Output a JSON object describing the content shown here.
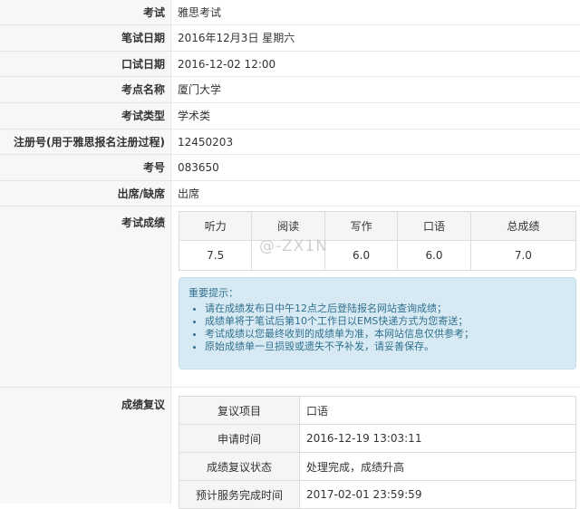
{
  "rows": [
    {
      "label": "考试",
      "value": "雅思考试"
    },
    {
      "label": "笔试日期",
      "value": "2016年12月3日 星期六"
    },
    {
      "label": "口试日期",
      "value": "2016-12-02 12:00"
    },
    {
      "label": "考点名称",
      "value": "厦门大学"
    },
    {
      "label": "考试类型",
      "value": "学术类"
    },
    {
      "label": "注册号(用于雅思报名注册过程)",
      "value": "12450203"
    },
    {
      "label": "考号",
      "value": "083650"
    },
    {
      "label": "出席/缺席",
      "value": "出席"
    }
  ],
  "scores": {
    "label": "考试成绩",
    "headers": [
      "听力",
      "阅读",
      "写作",
      "口语",
      "总成绩"
    ],
    "values": [
      "7.5",
      "",
      "6.0",
      "6.0",
      "7.0"
    ]
  },
  "watermark": "@-ZX1N",
  "notice": {
    "title": "重要提示：",
    "items": [
      "请在成绩发布日中午12点之后登陆报名网站查询成绩；",
      "成绩单将于笔试后第10个工作日以EMS快递方式为您寄送；",
      "考试成绩以您最终收到的成绩单为准，本网站信息仅供参考；",
      "原始成绩单一旦损毁或遗失不予补发，请妥善保存。"
    ]
  },
  "review": {
    "label": "成绩复议",
    "rows": [
      {
        "key": "复议项目",
        "value": "口语"
      },
      {
        "key": "申请时间",
        "value": "2016-12-19 13:03:11"
      },
      {
        "key": "成绩复议状态",
        "value": "处理完成，成绩升高"
      },
      {
        "key": "预计服务完成时间",
        "value": "2017-02-01 23:59:59"
      }
    ]
  }
}
